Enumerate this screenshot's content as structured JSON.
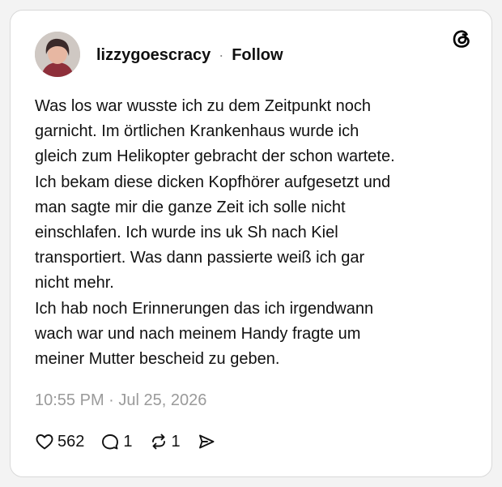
{
  "post": {
    "username": "lizzygoescracy",
    "separator": "·",
    "follow_label": "Follow",
    "body_lines": [
      "Was los war wusste ich zu dem Zeitpunkt noch",
      "garnicht. Im örtlichen Krankenhaus wurde ich",
      "gleich zum Helikopter gebracht der schon wartete.",
      "Ich bekam diese dicken Kopfhörer aufgesetzt und",
      "man sagte mir die ganze Zeit ich solle nicht",
      "einschlafen. Ich wurde ins uk Sh nach Kiel",
      "transportiert. Was dann passierte weiß ich gar",
      "nicht mehr.",
      "Ich hab noch Erinnerungen das ich irgendwann",
      "wach war und nach meinem Handy fragte um",
      "meiner Mutter bescheid zu geben."
    ],
    "timestamp": "10:55 PM · Jul 25, 2026",
    "likes": "562",
    "replies": "1",
    "reposts": "1"
  },
  "icons": {
    "brand": "threads-logo-icon",
    "like": "heart-icon",
    "reply": "comment-bubble-icon",
    "repost": "repost-arrows-icon",
    "share": "send-icon"
  },
  "colors": {
    "text": "#101010",
    "muted": "#9a9a9a",
    "card_border": "#d9d9d9"
  }
}
